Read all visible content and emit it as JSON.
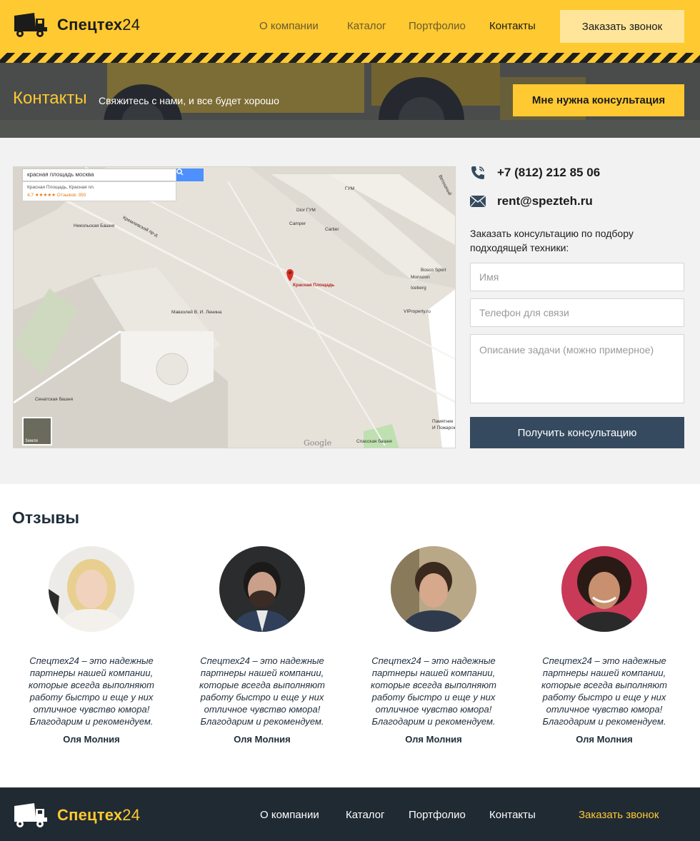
{
  "header": {
    "brand_main": "Спецтех",
    "brand_num": "24",
    "nav": [
      "О компании",
      "Каталог",
      "Портфолио",
      "Контакты"
    ],
    "call_button": "Заказать звонок"
  },
  "hero": {
    "title": "Контакты",
    "subtitle": "Свяжитесь с нами, и все будет хорошо",
    "consult_button": "Мне нужна консультация"
  },
  "map": {
    "search_value": "красная площадь москва",
    "suggest_title": "Красная Площадь, Красная пл.",
    "suggest_rating": "4,7 ★★★★★ Отзывов: 350",
    "labels": {
      "gum": "ГУМ",
      "dior": "Dior ГУМ",
      "camper": "Camper",
      "cartier": "Cartier",
      "nikolskaya": "Никольская Башня",
      "krasnaya": "Красная Площадь",
      "mausoleum": "Мавзолей В. И. Ленина",
      "bosco": "Bosco Sport",
      "monsoon": "Monsoon",
      "iceberg": "Iceberg",
      "viproperty": "VIProperty.ru",
      "senatskaya": "Сенатская башня",
      "pamyatnik": "Памятник",
      "minin": "И Пожарск",
      "spasskaya": "Спасская башня",
      "kremlin_road": "Кремлевский пр-д",
      "vetoshny": "Ветошный",
      "google": "Google",
      "earth": "Земля"
    }
  },
  "contacts": {
    "phone": "+7 (812) 212 85 06",
    "email": "rent@spezteh.ru",
    "form_intro": "Заказать консультацию по подбору подходящей техники:",
    "name_placeholder": "Имя",
    "phone_placeholder": "Телефон для связи",
    "task_placeholder": "Описание задачи (можно примерное)",
    "submit": "Получить консультацию"
  },
  "reviews": {
    "title": "Отзывы",
    "items": [
      {
        "text": "Спецтех24 – это надежные партнеры нашей компании, которые всегда выполняют работу быстро и еще у них отличное чувство юмора! Благодарим и рекомендуем.",
        "name": "Оля Молния"
      },
      {
        "text": "Спецтех24 – это надежные партнеры нашей компании, которые всегда выполняют работу быстро и еще у них отличное чувство юмора! Благодарим и рекомендуем.",
        "name": "Оля Молния"
      },
      {
        "text": "Спецтех24 – это надежные партнеры нашей компании, которые всегда выполняют работу быстро и еще у них отличное чувство юмора! Благодарим и рекомендуем.",
        "name": "Оля Молния"
      },
      {
        "text": "Спецтех24 – это надежные партнеры нашей компании, которые всегда выполняют работу быстро и еще у них отличное чувство юмора! Благодарим и рекомендуем.",
        "name": "Оля Молния"
      }
    ]
  },
  "footer": {
    "brand_main": "Спецтех",
    "brand_num": "24",
    "nav": [
      "О компании",
      "Каталог",
      "Портфолио",
      "Контакты"
    ],
    "call": "Заказать звонок"
  },
  "colors": {
    "accent": "#fec931",
    "dark": "#202a33",
    "button_dark": "#354a5f"
  }
}
